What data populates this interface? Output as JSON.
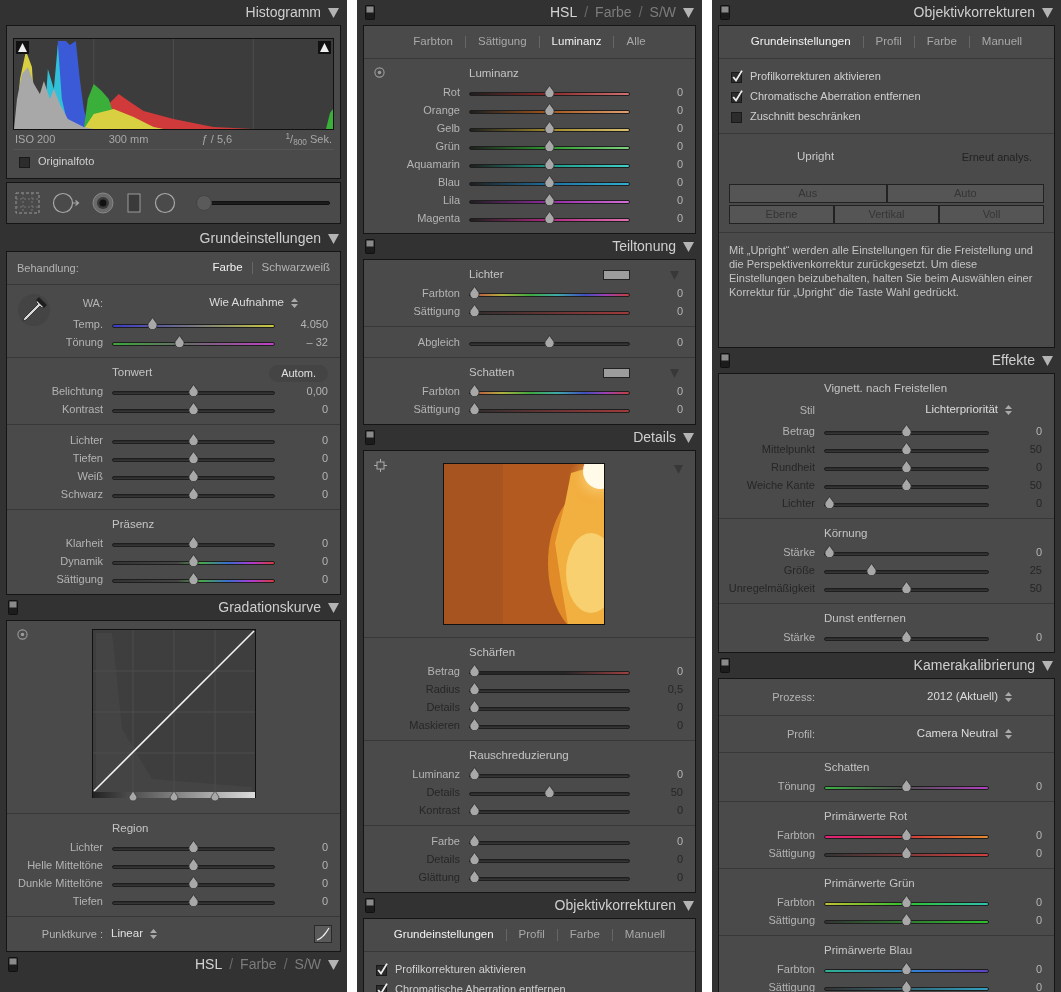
{
  "columns": [
    {
      "panels": [
        {
          "header": {
            "title": "Histogramm"
          },
          "sections": [
            {
              "rows": [
                {
                  "kind": "histogram"
                },
                {
                  "kind": "info",
                  "items": [
                    "ISO 200",
                    "300 mm",
                    "ƒ / 5,6",
                    "$^{1}$/$_{800}$ Sek."
                  ]
                },
                {
                  "kind": "checkbox",
                  "label": "Originalfoto",
                  "checked": false
                }
              ]
            }
          ]
        },
        {
          "sections": [
            {
              "rows": [
                {
                  "kind": "tools",
                  "level": 0
                }
              ]
            }
          ]
        },
        {
          "header": {
            "title": "Grundeinstellungen"
          },
          "sections": [
            {
              "rows": [
                {
                  "kind": "segmented",
                  "label": "Behandlung:",
                  "options": [
                    {
                      "text": "Farbe",
                      "selected": true
                    },
                    {
                      "text": "Schwarzweiß",
                      "selected": false
                    }
                  ]
                }
              ]
            },
            {
              "kind": "eyedropper",
              "rows": [
                {
                  "kind": "picker",
                  "label": "WA:",
                  "value": "Wie Aufnahme"
                },
                {
                  "kind": "temp",
                  "label": "Temp.",
                  "value": "4.050",
                  "level": 0.23,
                  "disabled": false
                },
                {
                  "kind": "tint",
                  "label": "Tönung",
                  "value": "– 32",
                  "level": 0.41,
                  "disabled": false
                }
              ]
            },
            {
              "rows": [
                {
                  "kind": "heading",
                  "text": "Tonwert",
                  "button": "Autom."
                },
                {
                  "kind": "slider",
                  "label": "Belichtung",
                  "value": "0,00",
                  "level": 0.5,
                  "disabled": false
                },
                {
                  "kind": "slider",
                  "label": "Kontrast",
                  "value": "0",
                  "level": 0.5,
                  "disabled": false
                }
              ]
            },
            {
              "rows": [
                {
                  "kind": "slider",
                  "label": "Lichter",
                  "value": "0",
                  "level": 0.5,
                  "disabled": false
                },
                {
                  "kind": "slider",
                  "label": "Tiefen",
                  "value": "0",
                  "level": 0.5,
                  "disabled": false
                },
                {
                  "kind": "slider",
                  "label": "Weiß",
                  "value": "0",
                  "level": 0.5,
                  "disabled": false
                },
                {
                  "kind": "slider",
                  "label": "Schwarz",
                  "value": "0",
                  "level": 0.5,
                  "disabled": false
                }
              ]
            },
            {
              "rows": [
                {
                  "kind": "heading",
                  "text": "Präsenz"
                },
                {
                  "kind": "slider",
                  "label": "Klarheit",
                  "value": "0",
                  "level": 0.5,
                  "disabled": false
                },
                {
                  "kind": "vibrance",
                  "label": "Dynamik",
                  "value": "0",
                  "level": 0.5,
                  "disabled": false
                },
                {
                  "kind": "vibrance",
                  "label": "Sättigung",
                  "value": "0",
                  "level": 0.5,
                  "disabled": false
                }
              ]
            }
          ]
        },
        {
          "header": {
            "title": "Gradationskurve",
            "switch": true
          },
          "sections": [
            {
              "kind": "target",
              "rows": [
                {
                  "kind": "curve"
                }
              ]
            },
            {
              "rows": [
                {
                  "kind": "heading",
                  "text": "Region"
                },
                {
                  "kind": "slider",
                  "label": "Lichter",
                  "value": "0",
                  "level": 0.5,
                  "disabled": false
                },
                {
                  "kind": "slider",
                  "label": "Helle Mitteltöne",
                  "value": "0",
                  "level": 0.5,
                  "disabled": false
                },
                {
                  "kind": "slider",
                  "label": "Dunkle Mitteltöne",
                  "value": "0",
                  "level": 0.5,
                  "disabled": false
                },
                {
                  "kind": "slider",
                  "label": "Tiefen",
                  "value": "0",
                  "level": 0.5,
                  "disabled": false
                }
              ]
            },
            {
              "rows": [
                {
                  "kind": "pointcurve",
                  "label": "Punktkurve :",
                  "value": "Linear"
                }
              ]
            }
          ]
        },
        {
          "header": {
            "titles": [
              {
                "text": "HSL",
                "selected": true
              },
              {
                "text": "Farbe",
                "selected": false
              },
              {
                "text": "S/W",
                "selected": false
              }
            ],
            "separator": "/",
            "switch": true
          }
        }
      ]
    },
    {
      "panels": [
        {
          "header": {
            "titles": [
              {
                "text": "HSL",
                "selected": true
              },
              {
                "text": "Farbe",
                "selected": false
              },
              {
                "text": "S/W",
                "selected": false
              }
            ],
            "separator": "/",
            "switch": true
          },
          "sections": [
            {
              "rows": [
                {
                  "kind": "tabs",
                  "tabs": [
                    {
                      "text": "Farbton",
                      "selected": false
                    },
                    {
                      "text": "Sättigung",
                      "selected": false
                    },
                    {
                      "text": "Luminanz",
                      "selected": true
                    },
                    {
                      "text": "Alle",
                      "selected": false
                    }
                  ]
                }
              ]
            },
            {
              "kind": "target",
              "rows": [
                {
                  "kind": "heading",
                  "text": "Luminanz"
                },
                {
                  "kind": "red",
                  "label": "Rot",
                  "value": "0",
                  "level": 0.5,
                  "disabled": false
                },
                {
                  "kind": "orange",
                  "label": "Orange",
                  "value": "0",
                  "level": 0.5,
                  "disabled": false
                },
                {
                  "kind": "yellow",
                  "label": "Gelb",
                  "value": "0",
                  "level": 0.5,
                  "disabled": false
                },
                {
                  "kind": "green",
                  "label": "Grün",
                  "value": "0",
                  "level": 0.5,
                  "disabled": false
                },
                {
                  "kind": "aqua",
                  "label": "Aquamarin",
                  "value": "0",
                  "level": 0.5,
                  "disabled": false
                },
                {
                  "kind": "blue",
                  "label": "Blau",
                  "value": "0",
                  "level": 0.5,
                  "disabled": false
                },
                {
                  "kind": "purple",
                  "label": "Lila",
                  "value": "0",
                  "level": 0.5,
                  "disabled": false
                },
                {
                  "kind": "magenta",
                  "label": "Magenta",
                  "value": "0",
                  "level": 0.5,
                  "disabled": false
                }
              ]
            }
          ]
        },
        {
          "header": {
            "title": "Teiltonung",
            "switch": true
          },
          "sections": [
            {
              "rows": [
                {
                  "kind": "heading",
                  "text": "Lichter",
                  "color": "#9c9c9c"
                },
                {
                  "kind": "hue",
                  "label": "Farbton",
                  "value": "0",
                  "level": 0,
                  "disabled": false
                },
                {
                  "kind": "sat",
                  "label": "Sättigung",
                  "value": "0",
                  "level": 0,
                  "disabled": false
                }
              ]
            },
            {
              "rows": [
                {
                  "kind": "slider",
                  "label": "Abgleich",
                  "value": "0",
                  "level": 0.5,
                  "disabled": false
                }
              ]
            },
            {
              "rows": [
                {
                  "kind": "heading",
                  "text": "Schatten",
                  "color": "#9c9c9c"
                },
                {
                  "kind": "hue",
                  "label": "Farbton",
                  "value": "0",
                  "level": 0,
                  "disabled": false
                },
                {
                  "kind": "sat",
                  "label": "Sättigung",
                  "value": "0",
                  "level": 0,
                  "disabled": false
                }
              ]
            }
          ]
        },
        {
          "header": {
            "title": "Details",
            "switch": true
          },
          "sections": [
            {
              "kind": "crosshair",
              "rows": [
                {
                  "kind": "preview"
                }
              ]
            },
            {
              "rows": [
                {
                  "kind": "heading",
                  "text": "Schärfen"
                },
                {
                  "kind": "sharpen",
                  "label": "Betrag",
                  "value": "0",
                  "level": 0,
                  "disabled": false
                },
                {
                  "kind": "slider",
                  "label": "Radius",
                  "value": "0,5",
                  "level": 0,
                  "disabled": true
                },
                {
                  "kind": "slider",
                  "label": "Details",
                  "value": "0",
                  "level": 0,
                  "disabled": true
                },
                {
                  "kind": "slider",
                  "label": "Maskieren",
                  "value": "0",
                  "level": 0,
                  "disabled": true
                }
              ]
            },
            {
              "rows": [
                {
                  "kind": "heading",
                  "text": "Rauschreduzierung"
                },
                {
                  "kind": "slider",
                  "label": "Luminanz",
                  "value": "0",
                  "level": 0,
                  "disabled": false
                },
                {
                  "kind": "slider",
                  "label": "Details",
                  "value": "50",
                  "level": 0.5,
                  "disabled": true
                },
                {
                  "kind": "slider",
                  "label": "Kontrast",
                  "value": "0",
                  "level": 0,
                  "disabled": true
                }
              ]
            },
            {
              "rows": [
                {
                  "kind": "slider",
                  "label": "Farbe",
                  "value": "0",
                  "level": 0,
                  "disabled": false
                },
                {
                  "kind": "slider",
                  "label": "Details",
                  "value": "0",
                  "level": 0,
                  "disabled": true
                },
                {
                  "kind": "slider",
                  "label": "Glättung",
                  "value": "0",
                  "level": 0,
                  "disabled": true
                }
              ]
            }
          ]
        },
        {
          "header": {
            "title": "Objektivkorrekturen",
            "switch": true
          },
          "sections": [
            {
              "rows": [
                {
                  "kind": "tabs",
                  "tabs": [
                    {
                      "text": "Grundeinstellungen",
                      "selected": true
                    },
                    {
                      "text": "Profil",
                      "selected": false
                    },
                    {
                      "text": "Farbe",
                      "selected": false
                    },
                    {
                      "text": "Manuell",
                      "selected": false
                    }
                  ]
                }
              ]
            },
            {
              "rows": [
                {
                  "kind": "checkbox",
                  "label": "Profilkorrekturen aktivieren",
                  "checked": true
                },
                {
                  "kind": "checkbox",
                  "label": "Chromatische Aberration entfernen",
                  "checked": true
                }
              ]
            }
          ]
        }
      ]
    },
    {
      "panels": [
        {
          "header": {
            "title": "Objektivkorrekturen",
            "switch": true
          },
          "sections": [
            {
              "rows": [
                {
                  "kind": "tabs",
                  "tabs": [
                    {
                      "text": "Grundeinstellungen",
                      "selected": true
                    },
                    {
                      "text": "Profil",
                      "selected": false
                    },
                    {
                      "text": "Farbe",
                      "selected": false
                    },
                    {
                      "text": "Manuell",
                      "selected": false
                    }
                  ]
                }
              ]
            },
            {
              "rows": [
                {
                  "kind": "checkbox",
                  "label": "Profilkorrekturen aktivieren",
                  "checked": true
                },
                {
                  "kind": "checkbox",
                  "label": "Chromatische Aberration entfernen",
                  "checked": true
                },
                {
                  "kind": "checkbox",
                  "label": "Zuschnitt beschränken",
                  "checked": false
                }
              ]
            },
            {
              "rows": [
                {
                  "kind": "upright",
                  "label": "Upright",
                  "button": "Erneut analys."
                },
                {
                  "kind": "buttons",
                  "buttons": [
                    "Aus",
                    "Auto"
                  ]
                },
                {
                  "kind": "buttons",
                  "buttons": [
                    "Ebene",
                    "Vertikal",
                    "Voll"
                  ]
                }
              ]
            },
            {
              "rows": [
                {
                  "kind": "paragraph",
                  "text": "Mit „Upright“ werden alle Einstellungen für die Freistellung und die Perspektivenkorrektur zurückgesetzt. Um diese Einstellungen beizubehalten, halten Sie beim Auswählen einer Korrektur für „Upright“ die Taste Wahl gedrückt."
                }
              ]
            }
          ]
        },
        {
          "header": {
            "title": "Effekte",
            "switch": true
          },
          "sections": [
            {
              "rows": [
                {
                  "kind": "heading",
                  "text": "Vignett. nach Freistellen"
                },
                {
                  "kind": "picker",
                  "label": "Stil",
                  "value": "Lichterpriorität"
                },
                {
                  "kind": "slider",
                  "label": "Betrag",
                  "value": "0",
                  "level": 0.5,
                  "disabled": false
                },
                {
                  "kind": "slider",
                  "label": "Mittelpunkt",
                  "value": "50",
                  "level": 0.5,
                  "disabled": true
                },
                {
                  "kind": "slider",
                  "label": "Rundheit",
                  "value": "0",
                  "level": 0.5,
                  "disabled": true
                },
                {
                  "kind": "slider",
                  "label": "Weiche Kante",
                  "value": "50",
                  "level": 0.5,
                  "disabled": true
                },
                {
                  "kind": "slider",
                  "label": "Lichter",
                  "value": "0",
                  "level": 0,
                  "disabled": true
                }
              ]
            },
            {
              "rows": [
                {
                  "kind": "heading",
                  "text": "Körnung"
                },
                {
                  "kind": "slider",
                  "label": "Stärke",
                  "value": "0",
                  "level": 0,
                  "disabled": false
                },
                {
                  "kind": "slider",
                  "label": "Größe",
                  "value": "25",
                  "level": 0.27,
                  "disabled": true
                },
                {
                  "kind": "slider",
                  "label": "Unregelmäßigkeit",
                  "value": "50",
                  "level": 0.5,
                  "disabled": true
                }
              ]
            },
            {
              "rows": [
                {
                  "kind": "heading",
                  "text": "Dunst entfernen"
                },
                {
                  "kind": "slider",
                  "label": "Stärke",
                  "value": "0",
                  "level": 0.5,
                  "disabled": false
                }
              ]
            }
          ]
        },
        {
          "header": {
            "title": "Kamerakalibrierung",
            "switch": true
          },
          "sections": [
            {
              "rows": [
                {
                  "kind": "picker",
                  "label": "Prozess:",
                  "value": "2012 (Aktuell)"
                }
              ]
            },
            {
              "rows": [
                {
                  "kind": "picker",
                  "label": "Profil:",
                  "value": "Camera Neutral"
                }
              ]
            },
            {
              "rows": [
                {
                  "kind": "heading",
                  "text": "Schatten"
                },
                {
                  "kind": "caltint",
                  "label": "Tönung",
                  "value": "0",
                  "level": 0.5,
                  "disabled": false
                }
              ]
            },
            {
              "rows": [
                {
                  "kind": "heading",
                  "text": "Primärwerte Rot"
                },
                {
                  "kind": "redhue",
                  "label": "Farbton",
                  "value": "0",
                  "level": 0.5,
                  "disabled": false
                },
                {
                  "kind": "redsat",
                  "label": "Sättigung",
                  "value": "0",
                  "level": 0.5,
                  "disabled": false
                }
              ]
            },
            {
              "rows": [
                {
                  "kind": "heading",
                  "text": "Primärwerte Grün"
                },
                {
                  "kind": "greenhue",
                  "label": "Farbton",
                  "value": "0",
                  "level": 0.5,
                  "disabled": false
                },
                {
                  "kind": "greensat",
                  "label": "Sättigung",
                  "value": "0",
                  "level": 0.5,
                  "disabled": false
                }
              ]
            },
            {
              "rows": [
                {
                  "kind": "heading",
                  "text": "Primärwerte Blau"
                },
                {
                  "kind": "bluehue",
                  "label": "Farbton",
                  "value": "0",
                  "level": 0.5,
                  "disabled": false
                },
                {
                  "kind": "bluesat",
                  "label": "Sättigung",
                  "value": "0",
                  "level": 0.5,
                  "disabled": false
                }
              ]
            }
          ]
        }
      ]
    }
  ]
}
